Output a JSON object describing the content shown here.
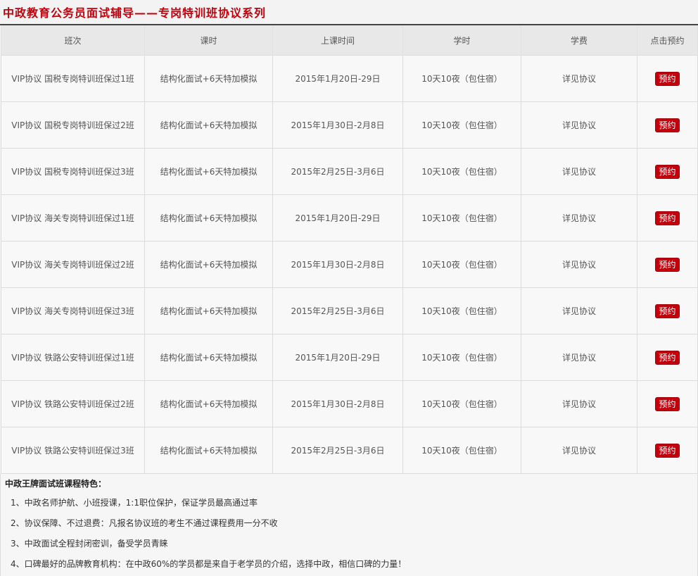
{
  "page_title": "中政教育公务员面试辅导——专岗特训班协议系列",
  "columns": [
    "班次",
    "课时",
    "上课时间",
    "学时",
    "学费",
    "点击预约"
  ],
  "rows": [
    {
      "name": "VIP协议 国税专岗特训班保过1班",
      "hours": "结构化面试+6天特加模拟",
      "time": "2015年1月20日-29日",
      "period": "10天10夜（包住宿）",
      "fee": "详见协议",
      "action": "预约"
    },
    {
      "name": "VIP协议 国税专岗特训班保过2班",
      "hours": "结构化面试+6天特加模拟",
      "time": "2015年1月30日-2月8日",
      "period": "10天10夜（包住宿）",
      "fee": "详见协议",
      "action": "预约"
    },
    {
      "name": "VIP协议 国税专岗特训班保过3班",
      "hours": "结构化面试+6天特加模拟",
      "time": "2015年2月25日-3月6日",
      "period": "10天10夜（包住宿）",
      "fee": "详见协议",
      "action": "预约"
    },
    {
      "name": "VIP协议 海关专岗特训班保过1班",
      "hours": "结构化面试+6天特加模拟",
      "time": "2015年1月20日-29日",
      "period": "10天10夜（包住宿）",
      "fee": "详见协议",
      "action": "预约"
    },
    {
      "name": "VIP协议 海关专岗特训班保过2班",
      "hours": "结构化面试+6天特加模拟",
      "time": "2015年1月30日-2月8日",
      "period": "10天10夜（包住宿）",
      "fee": "详见协议",
      "action": "预约"
    },
    {
      "name": "VIP协议 海关专岗特训班保过3班",
      "hours": "结构化面试+6天特加模拟",
      "time": "2015年2月25日-3月6日",
      "period": "10天10夜（包住宿）",
      "fee": "详见协议",
      "action": "预约"
    },
    {
      "name": "VIP协议 铁路公安特训班保过1班",
      "hours": "结构化面试+6天特加模拟",
      "time": "2015年1月20日-29日",
      "period": "10天10夜（包住宿）",
      "fee": "详见协议",
      "action": "预约"
    },
    {
      "name": "VIP协议 铁路公安特训班保过2班",
      "hours": "结构化面试+6天特加模拟",
      "time": "2015年1月30日-2月8日",
      "period": "10天10夜（包住宿）",
      "fee": "详见协议",
      "action": "预约"
    },
    {
      "name": "VIP协议 铁路公安特训班保过3班",
      "hours": "结构化面试+6天特加模拟",
      "time": "2015年2月25日-3月6日",
      "period": "10天10夜（包住宿）",
      "fee": "详见协议",
      "action": "预约"
    }
  ],
  "features": {
    "title": "中政王牌面试班课程特色：",
    "items": [
      "1、中政名师护航、小班授课，1:1职位保护，保证学员最高通过率",
      "2、协议保障、不过退费：凡报名协议班的考生不通过课程费用一分不收",
      "3、中政面试全程封闭密训，备受学员青睐",
      "4、口碑最好的品牌教育机构：在中政60%的学员都是来自于老学员的介绍，选择中政，相信口碑的力量！"
    ]
  },
  "colors": {
    "accent": "#c3000b",
    "header_bg": "#e9e8e8",
    "border": "#dddcdc"
  }
}
